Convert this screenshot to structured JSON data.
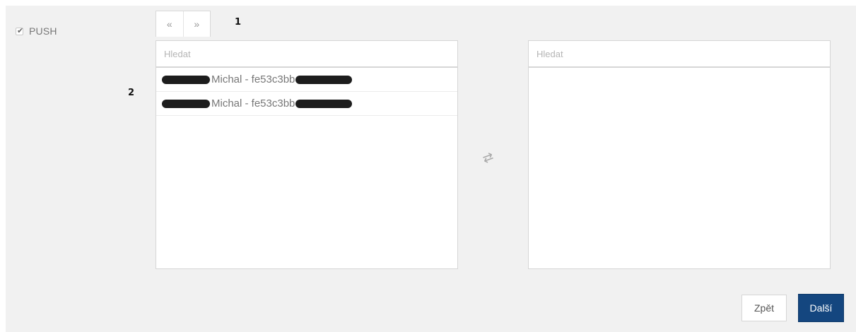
{
  "push": {
    "label": "PUSH",
    "checked": true
  },
  "markers": {
    "one": "1",
    "two": "2"
  },
  "nav": {
    "move_all_left": "«",
    "move_all_right": "»"
  },
  "left_list": {
    "search_placeholder": "Hledat",
    "items": [
      {
        "label": "Michal - fe53c3bb",
        "redacted": true
      },
      {
        "label": "Michal - fe53c3bb",
        "redacted": true
      }
    ]
  },
  "right_list": {
    "search_placeholder": "Hledat",
    "items": []
  },
  "transfer_icon": "⇄",
  "footer": {
    "back_label": "Zpět",
    "next_label": "Další"
  },
  "colors": {
    "panel_bg": "#f1f1f1",
    "primary_button": "#14467f"
  }
}
